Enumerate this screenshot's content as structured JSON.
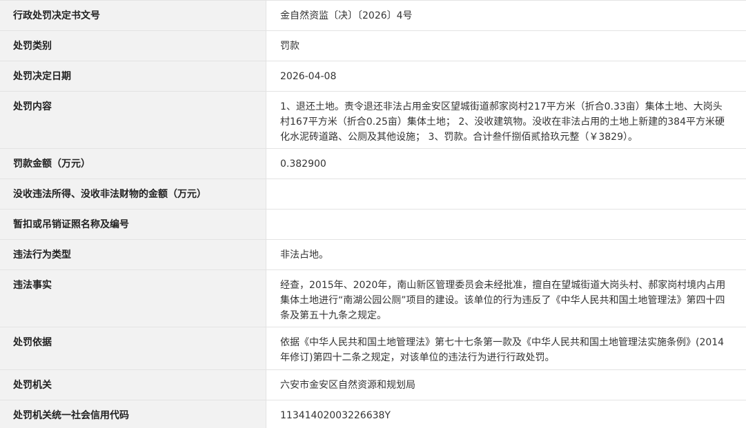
{
  "rows": [
    {
      "label": "行政处罚决定书文号",
      "value": "金自然资监〔决〕〔2026〕4号"
    },
    {
      "label": "处罚类别",
      "value": "罚款"
    },
    {
      "label": "处罚决定日期",
      "value": "2026-04-08"
    },
    {
      "label": "处罚内容",
      "value": "1、退还土地。责令退还非法占用金安区望城街道郝家岗村217平方米（折合0.33亩）集体土地、大岗头村167平方米（折合0.25亩）集体土地； 2、没收建筑物。没收在非法占用的土地上新建的384平方米硬化水泥砖道路、公厕及其他设施； 3、罚款。合计叁仟捌佰贰拾玖元整（￥3829）。"
    },
    {
      "label": "罚款金额（万元）",
      "value": "0.382900"
    },
    {
      "label": "没收违法所得、没收非法财物的金额（万元）",
      "value": ""
    },
    {
      "label": "暂扣或吊销证照名称及编号",
      "value": ""
    },
    {
      "label": "违法行为类型",
      "value": "非法占地。"
    },
    {
      "label": "违法事实",
      "value": "经查，2015年、2020年，南山新区管理委员会未经批准，擅自在望城街道大岗头村、郝家岗村境内占用集体土地进行“南湖公园公厕”项目的建设。该单位的行为违反了《中华人民共和国土地管理法》第四十四条及第五十九条之规定。"
    },
    {
      "label": "处罚依据",
      "value": "依据《中华人民共和国土地管理法》第七十七条第一款及《中华人民共和国土地管理法实施条例》(2014年修订)第四十二条之规定，对该单位的违法行为进行行政处罚。"
    },
    {
      "label": "处罚机关",
      "value": "六安市金安区自然资源和规划局"
    },
    {
      "label": "处罚机关统一社会信用代码",
      "value": "11341402003226638Y"
    }
  ]
}
